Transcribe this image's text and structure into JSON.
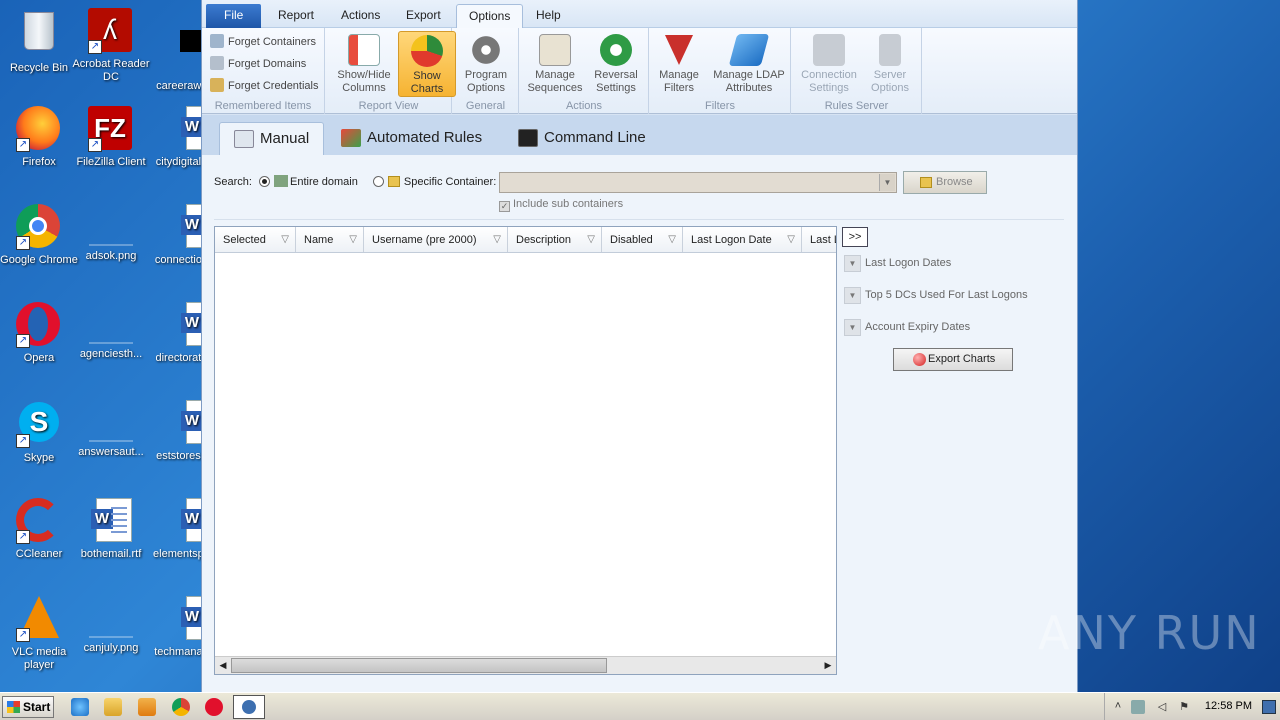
{
  "desktop": {
    "icons": [
      {
        "label": "Recycle Bin"
      },
      {
        "label": "Acrobat Reader DC"
      },
      {
        "label": "careeraw..."
      },
      {
        "label": "Firefox"
      },
      {
        "label": "FileZilla Client"
      },
      {
        "label": "citydigital..."
      },
      {
        "label": "Google Chrome"
      },
      {
        "label": "adsok.png"
      },
      {
        "label": "connectio..."
      },
      {
        "label": "Opera"
      },
      {
        "label": "agenciesth..."
      },
      {
        "label": "directorat..."
      },
      {
        "label": "Skype"
      },
      {
        "label": "answersaut..."
      },
      {
        "label": "eststores..."
      },
      {
        "label": "CCleaner"
      },
      {
        "label": "bothemail.rtf"
      },
      {
        "label": "elementsp..."
      },
      {
        "label": "VLC media player"
      },
      {
        "label": "canjuly.png"
      },
      {
        "label": "techmana..."
      }
    ]
  },
  "menu": {
    "file": "File",
    "report": "Report",
    "actions": "Actions",
    "export": "Export",
    "options": "Options",
    "help": "Help"
  },
  "ribbon": {
    "remembered": {
      "label": "Remembered Items",
      "forget_containers": "Forget Containers",
      "forget_domains": "Forget Domains",
      "forget_credentials": "Forget Credentials"
    },
    "report_view": {
      "label": "Report View",
      "show_hide_columns_1": "Show/Hide",
      "show_hide_columns_2": "Columns",
      "show_charts_1": "Show",
      "show_charts_2": "Charts"
    },
    "general": {
      "label": "General",
      "program_options_1": "Program",
      "program_options_2": "Options"
    },
    "actions": {
      "label": "Actions",
      "manage_sequences_1": "Manage",
      "manage_sequences_2": "Sequences",
      "reversal_settings_1": "Reversal",
      "reversal_settings_2": "Settings"
    },
    "filters": {
      "label": "Filters",
      "manage_filters_1": "Manage",
      "manage_filters_2": "Filters",
      "manage_ldap_1": "Manage LDAP",
      "manage_ldap_2": "Attributes"
    },
    "rules_server": {
      "label": "Rules Server",
      "connection_settings_1": "Connection",
      "connection_settings_2": "Settings",
      "server_options_1": "Server",
      "server_options_2": "Options"
    }
  },
  "tabs": {
    "manual": "Manual",
    "automated_rules": "Automated Rules",
    "command_line": "Command Line"
  },
  "search": {
    "label": "Search:",
    "entire_domain": "Entire domain",
    "specific_container": "Specific Container:",
    "browse": "Browse",
    "include_sub": "Include sub containers"
  },
  "grid": {
    "columns": [
      "Selected",
      "Name",
      "Username (pre 2000)",
      "Description",
      "Disabled",
      "Last Logon Date",
      "Last L"
    ]
  },
  "charts": {
    "expand": ">>",
    "last_logon_dates": "Last Logon Dates",
    "top5_dcs": "Top 5 DCs Used For Last Logons",
    "account_expiry": "Account Expiry Dates",
    "export_charts": "Export Charts"
  },
  "watermark": "ANY RUN",
  "taskbar": {
    "start": "Start",
    "clock": "12:58 PM"
  }
}
